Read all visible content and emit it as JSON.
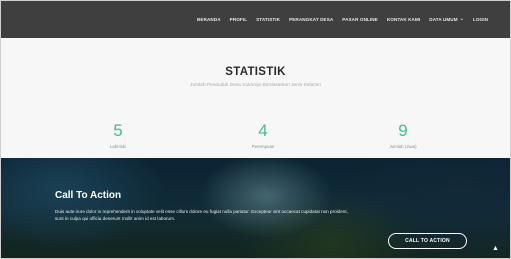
{
  "nav": {
    "items": [
      {
        "label": "BERANDA"
      },
      {
        "label": "PROFIL"
      },
      {
        "label": "STATISTIK"
      },
      {
        "label": "PERANGKAT DESA"
      },
      {
        "label": "PASAR ONLINE"
      },
      {
        "label": "KONTAK KAMI"
      },
      {
        "label": "DATA UMUM"
      },
      {
        "label": "LOGIN"
      }
    ]
  },
  "stats": {
    "title": "STATISTIK",
    "subtitle": "Jumlah Penduduk Desa Sukorejo Berdasarkan Jenis Kelamin",
    "items": [
      {
        "value": "5",
        "label": "Laki-laki"
      },
      {
        "value": "4",
        "label": "Perempuan"
      },
      {
        "value": "9",
        "label": "Jumlah (Jiwa)"
      }
    ],
    "accent_color": "#3fbf8f"
  },
  "cta": {
    "title": "Call To Action",
    "text": "Duis aute irure dolor in reprehenderit in voluptate velit esse cillum dolore eu fugiat nulla pariatur. Excepteur sint occaecat cupidatat non proident, sunt in culpa qui officia deserunt mollit anim id est laborum.",
    "button_label": "CALL TO ACTION"
  },
  "icons": {
    "dropdown": "chevron-down-icon",
    "scroll_top": "chevron-up-icon"
  }
}
